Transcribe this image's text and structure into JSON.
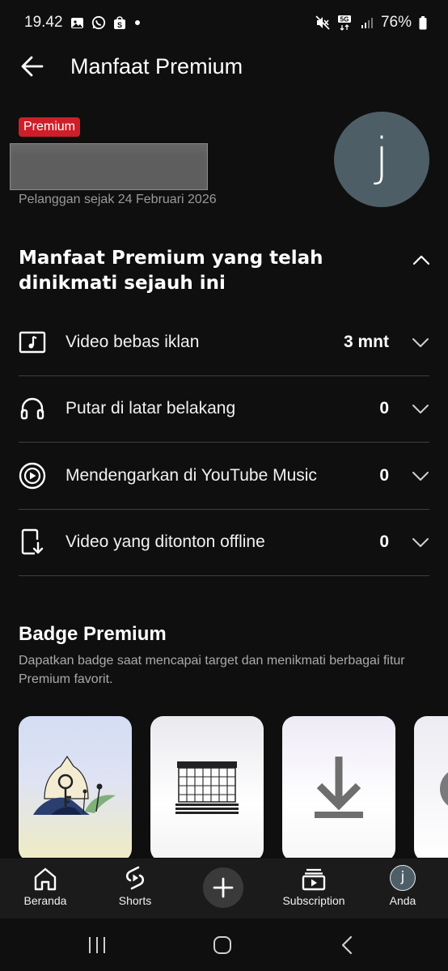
{
  "status_bar": {
    "time": "19.42",
    "battery": "76%",
    "network": "5G",
    "left_icons": [
      "gallery-icon",
      "whatsapp-icon",
      "shopee-icon",
      "dot-icon"
    ],
    "right_icons": [
      "mute-icon",
      "5g-icon",
      "signal-icon",
      "battery-icon"
    ]
  },
  "header": {
    "title": "Manfaat Premium",
    "back_icon": "arrow-left-icon"
  },
  "profile": {
    "badge": "Premium",
    "member_since": "Pelanggan sejak 24 Februari 2026",
    "avatar_letter": "j"
  },
  "benefits": {
    "title": "Manfaat Premium yang telah dinikmati sejauh ini",
    "items": [
      {
        "icon": "ad-free-video-icon",
        "label": "Video bebas iklan",
        "value": "3 mnt"
      },
      {
        "icon": "headphones-icon",
        "label": "Putar di latar belakang",
        "value": "0"
      },
      {
        "icon": "youtube-music-icon",
        "label": "Mendengarkan di YouTube Music",
        "value": "0"
      },
      {
        "icon": "offline-download-icon",
        "label": "Video yang ditonton offline",
        "value": "0"
      }
    ]
  },
  "badges": {
    "title": "Badge Premium",
    "description": "Dapatkan badge saat mencapai target dan menikmati berbagai fitur Premium favorit.",
    "cards": [
      "key-badge",
      "calendar-badge",
      "download-badge",
      "partial-badge"
    ]
  },
  "bottom_nav": {
    "items": [
      {
        "label": "Beranda",
        "icon": "home-icon"
      },
      {
        "label": "Shorts",
        "icon": "shorts-icon"
      },
      {
        "label": "",
        "icon": "plus-icon"
      },
      {
        "label": "Subscription",
        "icon": "subscriptions-icon"
      },
      {
        "label": "Anda",
        "icon": "avatar",
        "avatar_letter": "j"
      }
    ]
  },
  "colors": {
    "background": "#0f0f0f",
    "premium_red": "#cc1f2a",
    "avatar_bg": "#4e5e67",
    "divider": "#3f3f3f"
  }
}
